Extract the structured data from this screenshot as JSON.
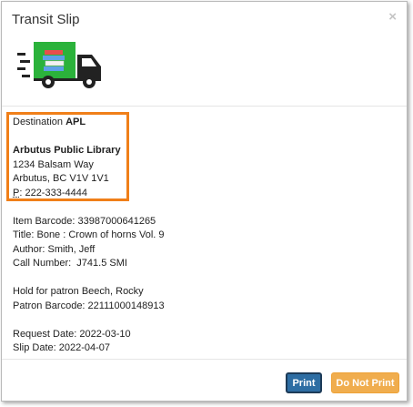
{
  "dialog": {
    "title": "Transit Slip",
    "close_glyph": "×"
  },
  "truck_icon": {
    "name": "delivery-truck-icon",
    "body_color": "#2bb23b",
    "cab_color": "#222222"
  },
  "destination": {
    "label": "Destination ",
    "code": "APL",
    "library_name": "Arbutus Public Library",
    "street": "1234 Balsam Way",
    "city": "Arbutus, BC V1V 1V1",
    "phone_label": "P",
    "phone_value": ": 222-333-4444"
  },
  "item": {
    "barcode": "Item Barcode: 33987000641265",
    "title": "Title: Bone : Crown of horns Vol. 9",
    "author": "Author: Smith, Jeff",
    "call_number": "Call Number:  J741.5 SMI"
  },
  "hold": {
    "patron": "Hold for patron Beech, Rocky",
    "patron_barcode": "Patron Barcode: 22111000148913"
  },
  "dates": {
    "request_date": "Request Date: 2022-03-10",
    "slip_date": "Slip Date: 2022-04-07"
  },
  "footer": {
    "print_label": "Print",
    "do_not_print_label": "Do Not Print"
  },
  "colors": {
    "highlight": "#f07f19",
    "print_button": "#2d6da3",
    "do_not_print_button": "#f0ad4e"
  }
}
